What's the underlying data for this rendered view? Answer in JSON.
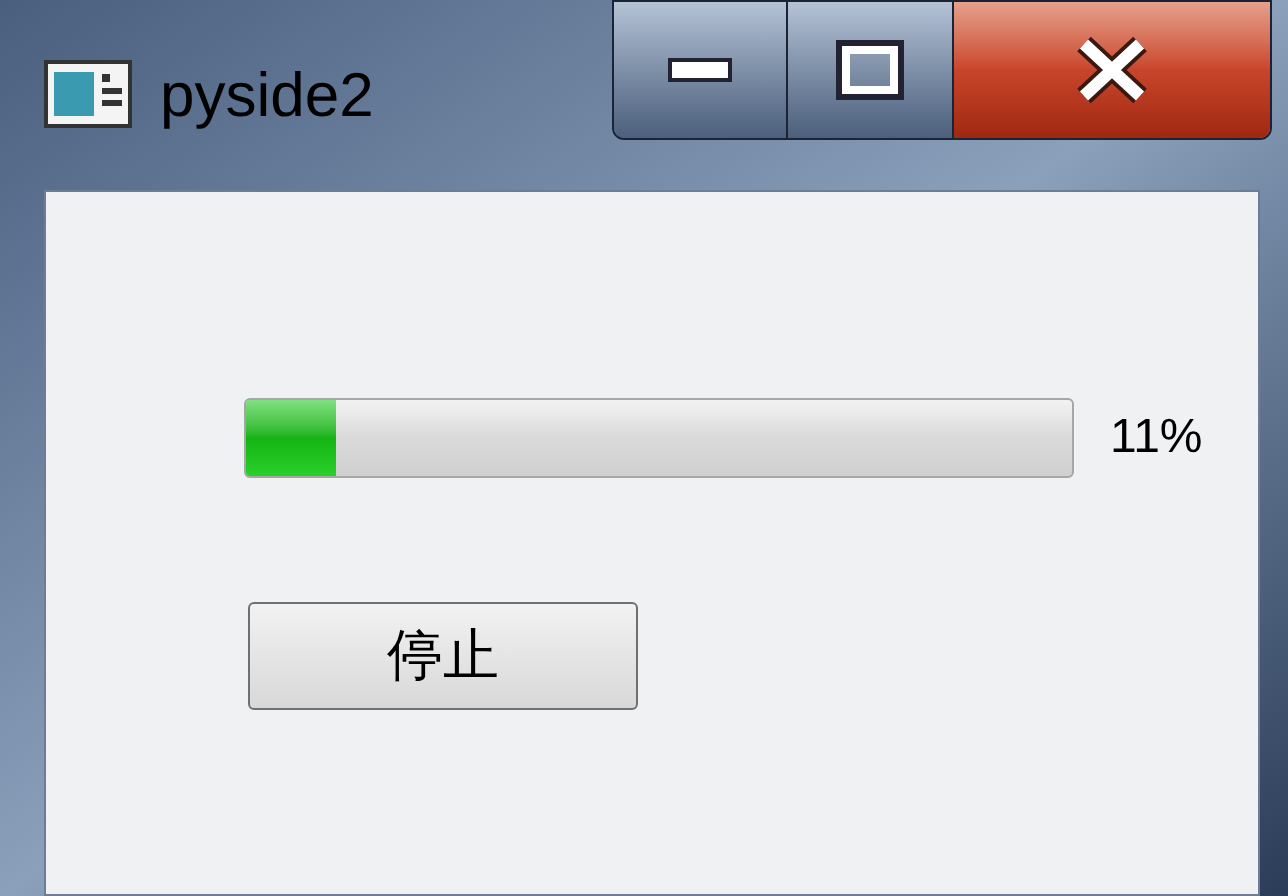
{
  "window": {
    "title": "pyside2"
  },
  "progress": {
    "level": 0.11,
    "reading": "11%"
  },
  "buttons": [
    {
      "label": "停止"
    }
  ]
}
